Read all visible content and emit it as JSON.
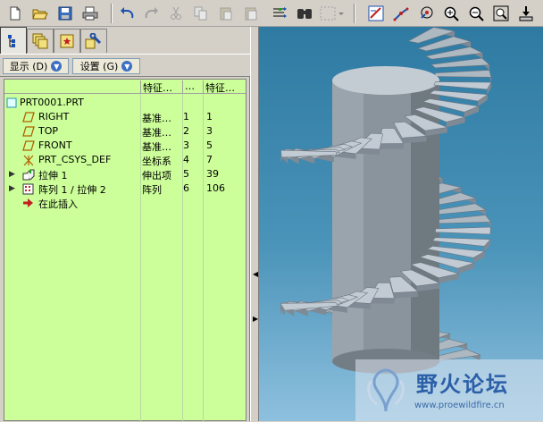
{
  "tree_menu": {
    "show_label": "显示 (D)",
    "settings_label": "设置 (G)"
  },
  "tree_columns": [
    "特征…",
    "…",
    "特征…"
  ],
  "tree_rows": [
    {
      "name": "PRT0001.PRT",
      "c1": "",
      "c2": "",
      "c3": "",
      "icon": "part-icon"
    },
    {
      "name": "RIGHT",
      "c1": "基准…",
      "c2": "1",
      "c3": "1",
      "icon": "datum-plane-icon"
    },
    {
      "name": "TOP",
      "c1": "基准…",
      "c2": "2",
      "c3": "3",
      "icon": "datum-plane-icon"
    },
    {
      "name": "FRONT",
      "c1": "基准…",
      "c2": "3",
      "c3": "5",
      "icon": "datum-plane-icon"
    },
    {
      "name": "PRT_CSYS_DEF",
      "c1": "坐标系",
      "c2": "4",
      "c3": "7",
      "icon": "csys-icon"
    },
    {
      "name": "拉伸 1",
      "c1": "伸出项",
      "c2": "5",
      "c3": "39",
      "icon": "extrude-icon"
    },
    {
      "name": "阵列 1 / 拉伸 2",
      "c1": "阵列",
      "c2": "6",
      "c3": "106",
      "icon": "pattern-icon"
    },
    {
      "name": "在此插入",
      "c1": "",
      "c2": "",
      "c3": "",
      "icon": "insert-here-arrow-icon"
    }
  ],
  "watermark": {
    "title": "野火论坛",
    "url": "www.proewildfire.cn"
  },
  "colors": {
    "tree_bg": "#ccff99",
    "viewport_top": "#2e7aa2",
    "viewport_bottom": "#8ec0de",
    "stair": "#b9c3cc",
    "column": "#8a949c"
  },
  "toolbar_icons": [
    "new-file-icon",
    "open-folder-icon",
    "save-icon",
    "print-icon",
    "undo-icon",
    "redo-icon",
    "cut-icon",
    "copy-icon",
    "paste-icon",
    "paste-special-icon",
    "regenerate-icon",
    "find-icon",
    "select-box-icon",
    "datum-display-icon",
    "spin-center-icon",
    "orient-icon",
    "zoom-in-icon",
    "zoom-out-icon",
    "refit-icon",
    "repaint-icon"
  ],
  "tab_icons": [
    "model-tree-tab-icon",
    "layers-tab-icon",
    "favorites-tab-icon",
    "tools-tab-icon"
  ]
}
